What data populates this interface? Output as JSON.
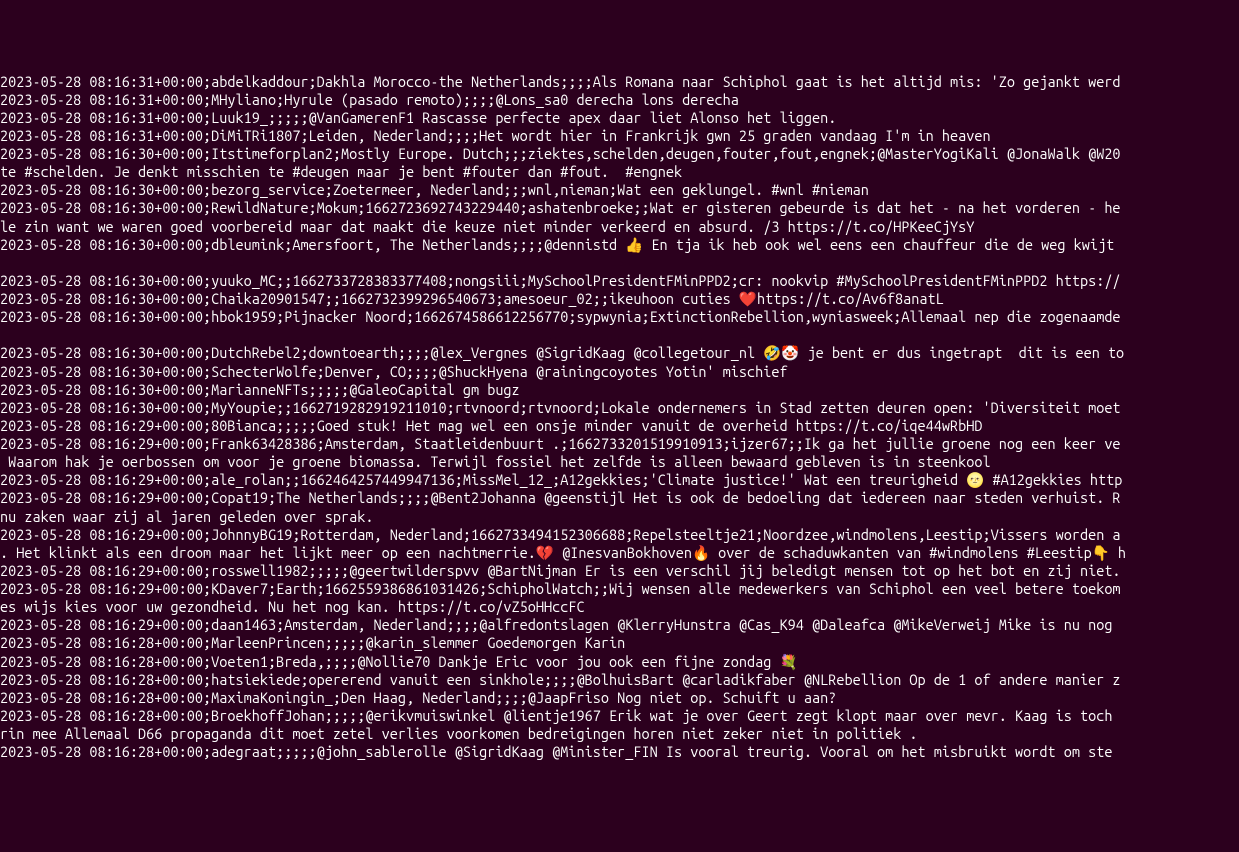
{
  "terminal": {
    "lines": [
      "2023-05-28 08:16:31+00:00;abdelkaddour;Dakhla Morocco-the Netherlands;;;;Als Romana naar Schiphol gaat is het altijd mis: 'Zo gejankt werd",
      "2023-05-28 08:16:31+00:00;MHyliano;Hyrule (pasado remoto);;;;@Lons_sa0 derecha lons derecha",
      "2023-05-28 08:16:31+00:00;Luuk19_;;;;;@VanGamerenF1 Rascasse perfecte apex daar liet Alonso het liggen.",
      "2023-05-28 08:16:31+00:00;DiMiTRi1807;Leiden, Nederland;;;;Het wordt hier in Frankrijk gwn 25 graden vandaag I'm in heaven",
      "2023-05-28 08:16:30+00:00;Itstimeforplan2;Mostly Europe. Dutch;;;ziektes,schelden,deugen,fouter,fout,engnek;@MasterYogiKali @JonaWalk @W20",
      "te #schelden. Je denkt misschien te #deugen maar je bent #fouter dan #fout.  #engnek",
      "2023-05-28 08:16:30+00:00;bezorg_service;Zoetermeer, Nederland;;;wnl,nieman;Wat een geklungel. #wnl #nieman",
      "2023-05-28 08:16:30+00:00;RewildNature;Mokum;1662723692743229440;ashatenbroeke;;Wat er gisteren gebeurde is dat het - na het vorderen - he",
      "le zin want we waren goed voorbereid maar dat maakt die keuze niet minder verkeerd en absurd. /3 https://t.co/HPKeeCjYsY",
      "2023-05-28 08:16:30+00:00;dbleumink;Amersfoort, The Netherlands;;;;@dennistd 👍 En tja ik heb ook wel eens een chauffeur die de weg kwijt ",
      "",
      "2023-05-28 08:16:30+00:00;yuuko_MC;;1662733728383377408;nongsiii;MySchoolPresidentFMinPPD2;cr: nookvip #MySchoolPresidentFMinPPD2 https://",
      "2023-05-28 08:16:30+00:00;Chaika20901547;;1662732399296540673;amesoeur_02;;ikeuhoon cuties ❤️https://t.co/Av6f8anatL",
      "2023-05-28 08:16:30+00:00;hbok1959;Pijnacker Noord;1662674586612256770;sypwynia;ExtinctionRebellion,wyniasweek;Allemaal nep die zogenaamde",
      "",
      "2023-05-28 08:16:30+00:00;DutchRebel2;downtoearth;;;;@lex_Vergnes @SigridKaag @collegetour_nl 🤣🤡 je bent er dus ingetrapt  dit is een to",
      "2023-05-28 08:16:30+00:00;SchecterWolfe;Denver, CO;;;;@ShuckHyena @rainingcoyotes Yotin' mischief",
      "2023-05-28 08:16:30+00:00;MarianneNFTs;;;;;@GaleoCapital gm bugz",
      "2023-05-28 08:16:30+00:00;MyYoupie;;1662719282919211010;rtvnoord;rtvnoord;Lokale ondernemers in Stad zetten deuren open: 'Diversiteit moet",
      "2023-05-28 08:16:29+00:00;80Bianca;;;;;Goed stuk! Het mag wel een onsje minder vanuit de overheid https://t.co/iqe44wRbHD",
      "2023-05-28 08:16:29+00:00;Frank63428386;Amsterdam, Staatleidenbuurt .;1662733201519910913;ijzer67;;Ik ga het jullie groene nog een keer ve",
      " Waarom hak je oerbossen om voor je groene biomassa. Terwijl fossiel het zelfde is alleen bewaard gebleven is in steenkool",
      "2023-05-28 08:16:29+00:00;ale_rolan;;1662464257449947136;MissMel_12_;A12gekkies;'Climate justice!' Wat een treurigheid 🌝 #A12gekkies http",
      "2023-05-28 08:16:29+00:00;Copat19;The Netherlands;;;;@Bent2Johanna @geenstijl Het is ook de bedoeling dat iedereen naar steden verhuist. R",
      "nu zaken waar zij al jaren geleden over sprak.",
      "2023-05-28 08:16:29+00:00;JohnnyBG19;Rotterdam, Nederland;1662733494152306688;Repelsteeltje21;Noordzee,windmolens,Leestip;Vissers worden a",
      ". Het klinkt als een droom maar het lijkt meer op een nachtmerrie.💔 @InesvanBokhoven🔥 over de schaduwkanten van #windmolens #Leestip👇 h",
      "2023-05-28 08:16:29+00:00;rosswell1982;;;;;@geertwilderspvv @BartNijman Er is een verschil jij beledigt mensen tot op het bot en zij niet.",
      "2023-05-28 08:16:29+00:00;KDaver7;Earth;1662559386861031426;SchipholWatch;;Wij wensen alle medewerkers van Schiphol een veel betere toekom",
      "es wijs kies voor uw gezondheid. Nu het nog kan. https://t.co/vZ5oHHccFC",
      "2023-05-28 08:16:29+00:00;daan1463;Amsterdam, Nederland;;;;@alfredontslagen @KlerryHunstra @Cas_K94 @Daleafca @MikeVerweij Mike is nu nog ",
      "2023-05-28 08:16:28+00:00;MarleenPrincen;;;;;@karin_slemmer Goedemorgen Karin",
      "2023-05-28 08:16:28+00:00;Voeten1;Breda,;;;;@Nollie70 Dankje Eric voor jou ook een fijne zondag 💐",
      "2023-05-28 08:16:28+00:00;hatsiekiede;opererend vanuit een sinkhole;;;;@BolhuisBart @carladikfaber @NLRebellion Op de 1 of andere manier z",
      "2023-05-28 08:16:28+00:00;MaximaKoningin_;Den Haag, Nederland;;;;@JaapFriso Nog niet op. Schuift u aan?",
      "2023-05-28 08:16:28+00:00;BroekhoffJohan;;;;;@erikvmuiswinkel @lientje1967 Erik wat je over Geert zegt klopt maar over mevr. Kaag is toch ",
      "rin mee Allemaal D66 propaganda dit moet zetel verlies voorkomen bedreigingen horen niet zeker niet in politiek .",
      "2023-05-28 08:16:28+00:00;adegraat;;;;;@john_sablerolle @SigridKaag @Minister_FIN Is vooral treurig. Vooral om het misbruikt wordt om ste"
    ]
  }
}
